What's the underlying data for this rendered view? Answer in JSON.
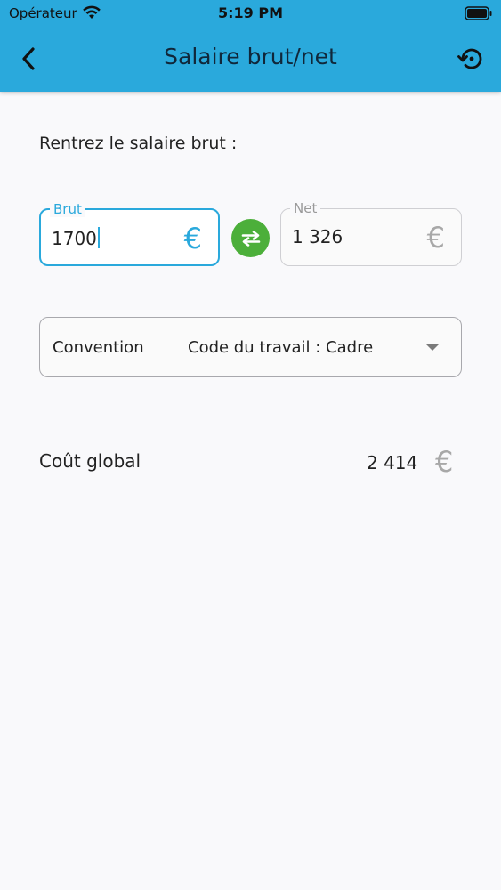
{
  "status_bar": {
    "carrier": "Opérateur",
    "time": "5:19 PM"
  },
  "header": {
    "title": "Salaire brut/net",
    "back_icon": "chevron-left-icon",
    "history_icon": "history-icon"
  },
  "prompt": "Rentrez le salaire brut :",
  "fields": {
    "brut": {
      "label": "Brut",
      "value": "1700",
      "currency": "€"
    },
    "net": {
      "label": "Net",
      "value": "1 326",
      "currency": "€"
    }
  },
  "convention": {
    "label": "Convention",
    "value": "Code du travail : Cadre"
  },
  "cost": {
    "label": "Coût global",
    "value": "2 414",
    "currency": "€"
  },
  "colors": {
    "accent": "#2aa9dc",
    "swap": "#4caf3a"
  }
}
